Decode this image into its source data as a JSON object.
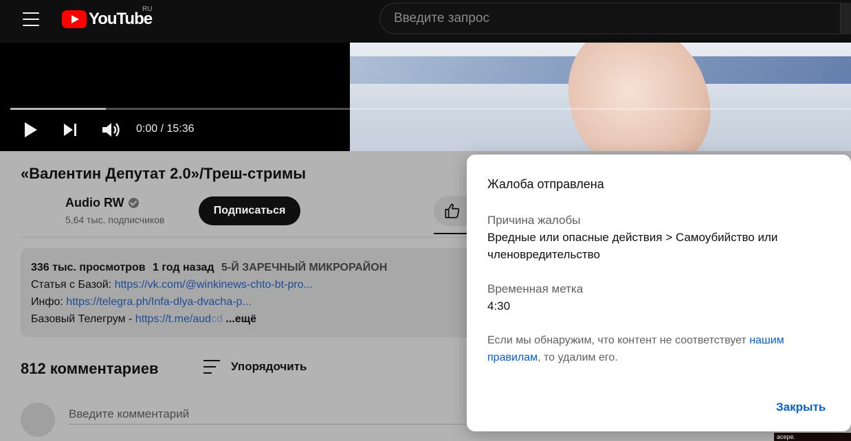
{
  "header": {
    "logo_text": "YouTube",
    "region": "RU",
    "search_placeholder": "Введите запрос"
  },
  "player": {
    "time": "0:00 / 15:36",
    "progress_fraction": 0.114
  },
  "video": {
    "title": "«Валентин Депутат 2.0»/Треш-стримы",
    "channel": "Audio RW",
    "subscribers": "5,64 тыс. подписчиков",
    "subscribe_label": "Подписаться"
  },
  "description": {
    "views": "336 тыс. просмотров",
    "age": "1 год назад",
    "tag": "5-Й ЗАРЕЧНЫЙ МИКРОРАЙОН",
    "line1_prefix": "Статья с Базой: ",
    "line1_link": "https://vk.com/@winkinews-chto-bt-pro...",
    "line2_prefix": "Инфо: ",
    "line2_link": "https://telegra.ph/Infa-dlya-dvacha-p...",
    "line3_prefix": "Базовый Телегрум - ",
    "line3_link": "https://t.me/aud",
    "line3_fade": "cd",
    "more": "...ещё"
  },
  "comments": {
    "count": "812 комментариев",
    "sort_label": "Упорядочить",
    "input_placeholder": "Введите комментарий"
  },
  "thumbnail_corner_text": "acepe.",
  "modal": {
    "title": "Жалоба отправлена",
    "reason_label": "Причина жалобы",
    "reason_value": "Вредные или опасные действия > Самоубийство или членовредительство",
    "timestamp_label": "Временная метка",
    "timestamp_value": "4:30",
    "note_prefix": "Если мы обнаружим, что контент не соответствует ",
    "note_link": "нашим правилам",
    "note_suffix": ", то удалим его.",
    "close_label": "Закрыть"
  }
}
